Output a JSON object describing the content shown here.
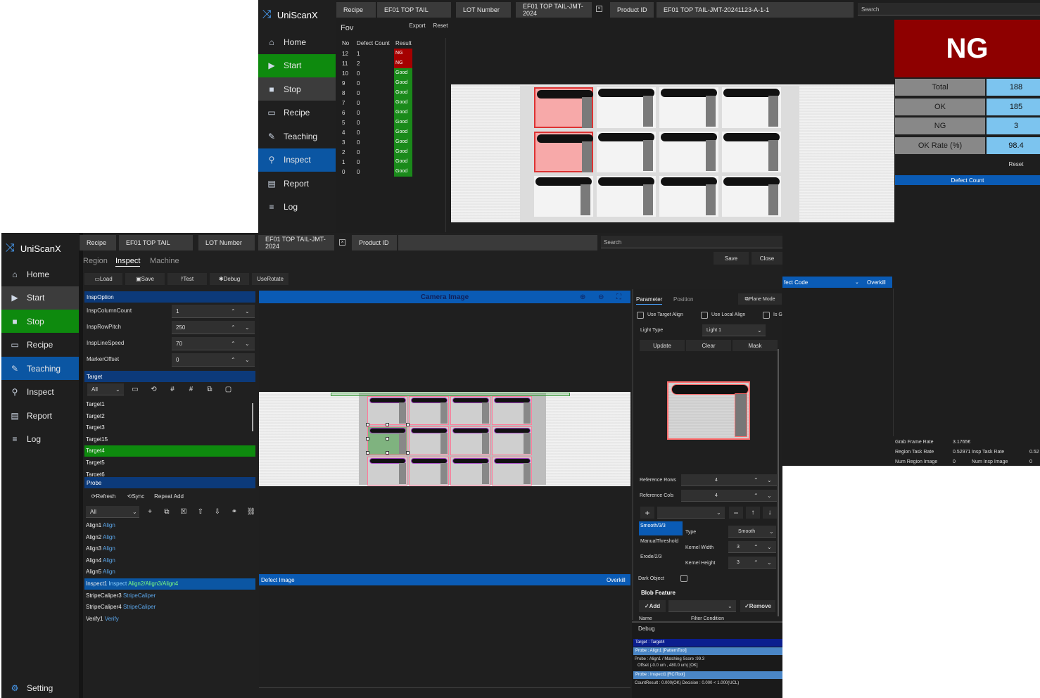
{
  "back_window": {
    "app_title": "UniScanX",
    "nav": [
      {
        "label": "Home",
        "icon": "home-icon"
      },
      {
        "label": "Start",
        "icon": "play-icon"
      },
      {
        "label": "Stop",
        "icon": "stop-icon"
      },
      {
        "label": "Recipe",
        "icon": "folder-icon"
      },
      {
        "label": "Teaching",
        "icon": "edit-icon"
      },
      {
        "label": "Inspect",
        "icon": "search-icon"
      },
      {
        "label": "Report",
        "icon": "report-icon"
      },
      {
        "label": "Log",
        "icon": "list-icon"
      }
    ],
    "header": {
      "recipe_label": "Recipe",
      "recipe_value": "EF01 TOP TAIL",
      "lot_label": "LOT Number",
      "lot_value": "EF01 TOP TAIL-JMT-2024",
      "product_label": "Product ID",
      "product_value": "EF01 TOP TAIL-JMT-20241123-A-1-1",
      "search_placeholder": "Search"
    },
    "fov": {
      "title": "Fov",
      "export_label": "Export",
      "reset_label": "Reset",
      "columns": [
        "No",
        "Defect Count",
        "Result"
      ],
      "rows": [
        [
          "12",
          "1",
          "NG"
        ],
        [
          "11",
          "2",
          "NG"
        ],
        [
          "10",
          "0",
          "Good"
        ],
        [
          "9",
          "0",
          "Good"
        ],
        [
          "8",
          "0",
          "Good"
        ],
        [
          "7",
          "0",
          "Good"
        ],
        [
          "6",
          "0",
          "Good"
        ],
        [
          "5",
          "0",
          "Good"
        ],
        [
          "4",
          "0",
          "Good"
        ],
        [
          "3",
          "0",
          "Good"
        ],
        [
          "2",
          "0",
          "Good"
        ],
        [
          "1",
          "0",
          "Good"
        ],
        [
          "0",
          "0",
          "Good"
        ]
      ]
    },
    "result_banner": "NG",
    "stats": [
      {
        "label": "Total",
        "value": "188"
      },
      {
        "label": "OK",
        "value": "185"
      },
      {
        "label": "NG",
        "value": "3"
      },
      {
        "label": "OK Rate (%)",
        "value": "98.4"
      }
    ],
    "stats_reset": "Reset",
    "defect_count_bar": "Defect Count",
    "defect_code_bar": "fect Code",
    "overkill_label": "Overkill",
    "rates": {
      "grab_frame_rate_label": "Grab Frame Rate",
      "grab_frame_rate_value": "3.1765€",
      "region_task_rate_label": "Region Task Rate",
      "region_task_rate_value": "0.52971",
      "insp_task_rate_label": "Insp Task Rate",
      "insp_task_rate_value": "0.52",
      "num_region_image_label": "Num Region Image",
      "num_region_image_value": "0",
      "num_insp_image_label": "Num Insp Image",
      "num_insp_image_value": "0"
    }
  },
  "front_window": {
    "app_title": "UniScanX",
    "nav": [
      {
        "label": "Home",
        "icon": "home-icon"
      },
      {
        "label": "Start",
        "icon": "play-icon"
      },
      {
        "label": "Stop",
        "icon": "stop-icon"
      },
      {
        "label": "Recipe",
        "icon": "folder-icon"
      },
      {
        "label": "Teaching",
        "icon": "edit-icon"
      },
      {
        "label": "Inspect",
        "icon": "search-icon"
      },
      {
        "label": "Report",
        "icon": "report-icon"
      },
      {
        "label": "Log",
        "icon": "list-icon"
      }
    ],
    "setting_label": "Setting",
    "header": {
      "recipe_label": "Recipe",
      "recipe_value": "EF01 TOP TAIL",
      "lot_label": "LOT Number",
      "lot_value": "EF01 TOP TAIL-JMT-2024",
      "product_label": "Product ID",
      "product_value": "",
      "search_placeholder": "Search"
    },
    "tabs": [
      "Region",
      "Inspect",
      "Machine"
    ],
    "save_label": "Save",
    "close_label": "Close",
    "toolbar": [
      "Load",
      "Save",
      "Test",
      "Debug",
      "UseRotate"
    ],
    "insp_option": {
      "title": "InspOption",
      "rows": [
        {
          "label": "InspColumnCount",
          "value": "1"
        },
        {
          "label": "InspRowPitch",
          "value": "250"
        },
        {
          "label": "InspLineSpeed",
          "value": "70"
        },
        {
          "label": "MarkerOffset",
          "value": "0"
        }
      ]
    },
    "target": {
      "title": "Target",
      "filter": "All",
      "items": [
        "Target1",
        "Target2",
        "Target3",
        "Target15",
        "Target4",
        "Target5",
        "Target6"
      ],
      "selected_index": 4
    },
    "probe": {
      "title": "Probe",
      "refresh_label": "Refresh",
      "sync_label": "Sync",
      "repeat_add_label": "Repeat Add",
      "filter": "All",
      "items": [
        {
          "name": "Align1",
          "type": "Align",
          "extra": ""
        },
        {
          "name": "Align2",
          "type": "Align",
          "extra": ""
        },
        {
          "name": "Align3",
          "type": "Align",
          "extra": ""
        },
        {
          "name": "Align4",
          "type": "Align",
          "extra": ""
        },
        {
          "name": "Align5",
          "type": "Align",
          "extra": ""
        },
        {
          "name": "Inspect1",
          "type": "Inspect",
          "extra": "Align2/Align3/Align4"
        },
        {
          "name": "StripeCaliper3",
          "type": "StripeCaliper",
          "extra": ""
        },
        {
          "name": "StripeCaliper4",
          "type": "StripeCaliper",
          "extra": ""
        },
        {
          "name": "Verify1",
          "type": "Verify",
          "extra": ""
        }
      ],
      "selected_index": 5
    },
    "camera_image_title": "Camera Image",
    "defect_image_title": "Defect Image",
    "overkill_label": "Overkill",
    "parameter": {
      "tabs": [
        "Parameter",
        "Position"
      ],
      "plane_mode": "Plane Mode",
      "use_target_align": "Use Target Align",
      "use_local_align": "Use Local Align",
      "is_g": "Is G",
      "light_type_label": "Light Type",
      "light_type_value": "Light 1",
      "update_label": "Update",
      "clear_label": "Clear",
      "mask_label": "Mask",
      "reference_rows_label": "Reference Rows",
      "reference_rows_value": "4",
      "reference_cols_label": "Reference Cols",
      "reference_cols_value": "4",
      "filters": [
        "Smooth/3/3",
        "ManualThreshold",
        "Erode/2/3"
      ],
      "type_label": "Type",
      "type_value": "Smooth",
      "kernel_width_label": "Kernel Width",
      "kernel_width_value": "3",
      "kernel_height_label": "Kernel Height",
      "kernel_height_value": "3",
      "dark_object_label": "Dark Object",
      "blob_feature_label": "Blob Feature",
      "add_label": "Add",
      "remove_label": "Remove",
      "name_col": "Name",
      "filter_condition_col": "Filter Condition"
    },
    "debug": {
      "title": "Debug",
      "lines": [
        "Target : Target4",
        "Probe : Align1 [PatternTool]",
        "Probe : Align1 / Matching Score :99.3",
        "Offset (-0.0 um , 480.0 um) [OK]",
        "Probe : Inspect1 [RCITool]",
        "CountResult : 0.000(OK) Decision : 0.000 < 1.000(UCL)"
      ]
    }
  }
}
